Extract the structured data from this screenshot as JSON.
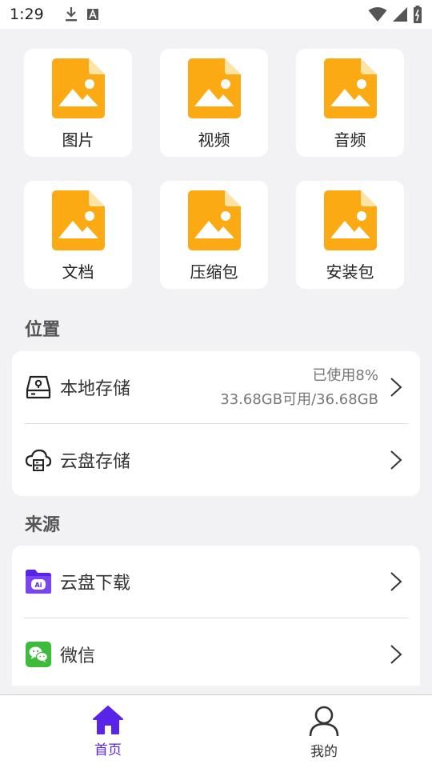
{
  "status_bar": {
    "time": "1:29",
    "icons": [
      "download-icon",
      "font-icon",
      "wifi-icon",
      "signal-icon",
      "battery-icon"
    ]
  },
  "categories": [
    {
      "label": "图片",
      "icon": "image-file-icon"
    },
    {
      "label": "视频",
      "icon": "image-file-icon"
    },
    {
      "label": "音频",
      "icon": "image-file-icon"
    },
    {
      "label": "文档",
      "icon": "image-file-icon"
    },
    {
      "label": "压缩包",
      "icon": "image-file-icon"
    },
    {
      "label": "安装包",
      "icon": "image-file-icon"
    }
  ],
  "location": {
    "title": "位置",
    "items": [
      {
        "label": "本地存储",
        "icon": "hard-drive-icon",
        "usage": "已使用8%",
        "capacity": "33.68GB可用/36.68GB"
      },
      {
        "label": "云盘存储",
        "icon": "cloud-drive-icon"
      }
    ]
  },
  "source": {
    "title": "来源",
    "items": [
      {
        "label": "云盘下载",
        "icon": "cloud-download-folder-icon"
      },
      {
        "label": "微信",
        "icon": "wechat-icon"
      }
    ]
  },
  "bottom_nav": {
    "items": [
      {
        "label": "首页",
        "icon": "home-icon",
        "active": true
      },
      {
        "label": "我的",
        "icon": "user-icon",
        "active": false
      }
    ]
  },
  "colors": {
    "accent": "#5a23e8",
    "file_icon": "#fbaa14",
    "file_icon_fold": "#fde3a4",
    "wechat": "#3dbb3a",
    "background": "#f2f2f4"
  }
}
